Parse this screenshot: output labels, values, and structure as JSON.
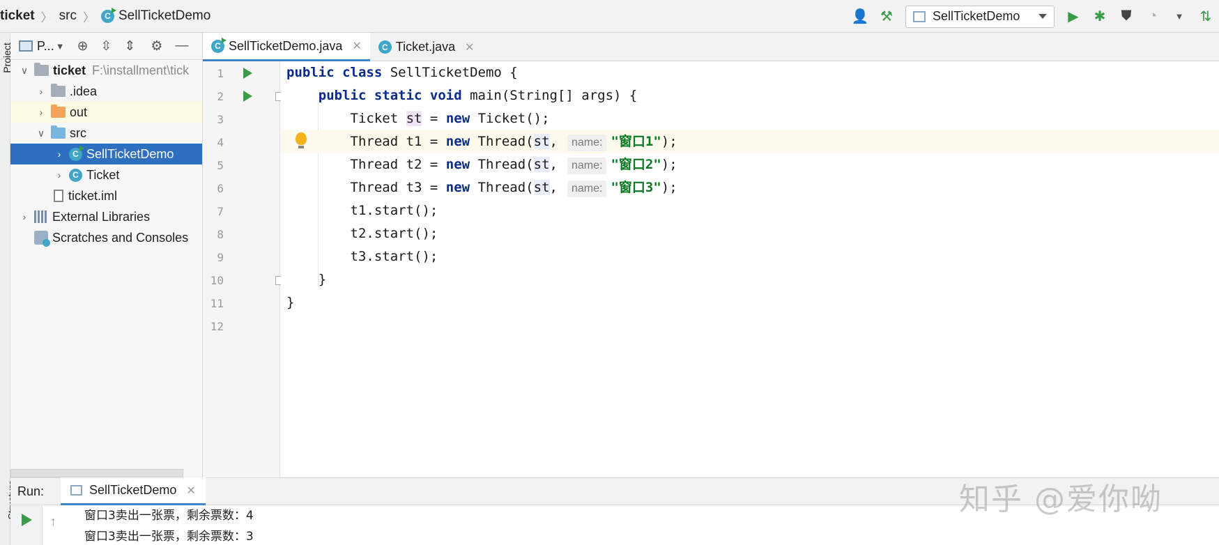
{
  "breadcrumb": {
    "project": "ticket",
    "folder": "src",
    "file": "SellTicketDemo"
  },
  "run_config": {
    "name": "SellTicketDemo"
  },
  "toolbar": {
    "user_icon": "user-icon",
    "build_icon": "hammer-icon",
    "run_icon": "play-icon",
    "debug_icon": "bug-icon",
    "coverage_icon": "coverage-icon",
    "profile_icon": "profile-icon",
    "more_icon": "chevron-down-icon",
    "vcs_icon": "vcs-icon"
  },
  "left_stripe": {
    "project_label": "Project",
    "structure_label": "Structure"
  },
  "project_panel": {
    "title": "P...",
    "tree": [
      {
        "label": "ticket",
        "path": "F:\\installment\\tick"
      },
      {
        "label": ".idea"
      },
      {
        "label": "out"
      },
      {
        "label": "src"
      },
      {
        "label": "SellTicketDemo"
      },
      {
        "label": "Ticket"
      },
      {
        "label": "ticket.iml"
      },
      {
        "label": "External Libraries"
      },
      {
        "label": "Scratches and Consoles"
      }
    ]
  },
  "tabs": [
    {
      "label": "SellTicketDemo.java"
    },
    {
      "label": "Ticket.java"
    }
  ],
  "editor": {
    "line_numbers": [
      "1",
      "2",
      "3",
      "4",
      "5",
      "6",
      "7",
      "8",
      "9",
      "10",
      "11",
      "12"
    ],
    "hint_label": "name:",
    "strings": [
      "\"窗口1\"",
      "\"窗口2\"",
      "\"窗口3\""
    ]
  },
  "run_panel": {
    "label": "Run:",
    "tab": "SellTicketDemo",
    "output": [
      "窗口3卖出一张票，剩余票数：4",
      "窗口3卖出一张票，剩余票数：3"
    ]
  },
  "watermark": "知乎 @爱你呦",
  "colors": {
    "keyword": "#0a2a8c",
    "string": "#0c7a24",
    "selection": "#2f6fc0",
    "run_green": "#3a9b49"
  }
}
